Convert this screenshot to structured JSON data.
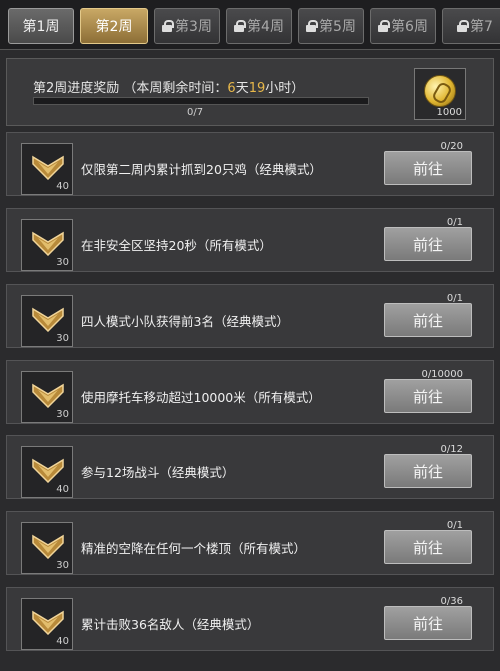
{
  "tabs": [
    {
      "label": "第1周",
      "locked": false
    },
    {
      "label": "第2周",
      "locked": false
    },
    {
      "label": "第3周",
      "locked": true
    },
    {
      "label": "第4周",
      "locked": true
    },
    {
      "label": "第5周",
      "locked": true
    },
    {
      "label": "第6周",
      "locked": true
    },
    {
      "label": "第7",
      "locked": true
    }
  ],
  "progress": {
    "title_prefix": "第2周进度奖励 （本周剩余时间：",
    "days_num": "6",
    "days_unit": "天",
    "hours_num": "19",
    "hours_unit": "小时）",
    "count": "0/7",
    "fraction": 0,
    "reward_count": "1000"
  },
  "tasks": [
    {
      "desc": "仅限第二周内累计抓到20只鸡（经典模式）",
      "progress": "0/20",
      "icon_count": "40",
      "button": "前往"
    },
    {
      "desc": "在非安全区坚持20秒（所有模式）",
      "progress": "0/1",
      "icon_count": "30",
      "button": "前往"
    },
    {
      "desc": "四人模式小队获得前3名（经典模式）",
      "progress": "0/1",
      "icon_count": "30",
      "button": "前往"
    },
    {
      "desc": "使用摩托车移动超过10000米（所有模式）",
      "progress": "0/10000",
      "icon_count": "30",
      "button": "前往"
    },
    {
      "desc": "参与12场战斗（经典模式）",
      "progress": "0/12",
      "icon_count": "40",
      "button": "前往"
    },
    {
      "desc": "精准的空降在任何一个楼顶（所有模式）",
      "progress": "0/1",
      "icon_count": "30",
      "button": "前往"
    },
    {
      "desc": "累计击败36名敌人（经典模式）",
      "progress": "0/36",
      "icon_count": "40",
      "button": "前往"
    }
  ]
}
